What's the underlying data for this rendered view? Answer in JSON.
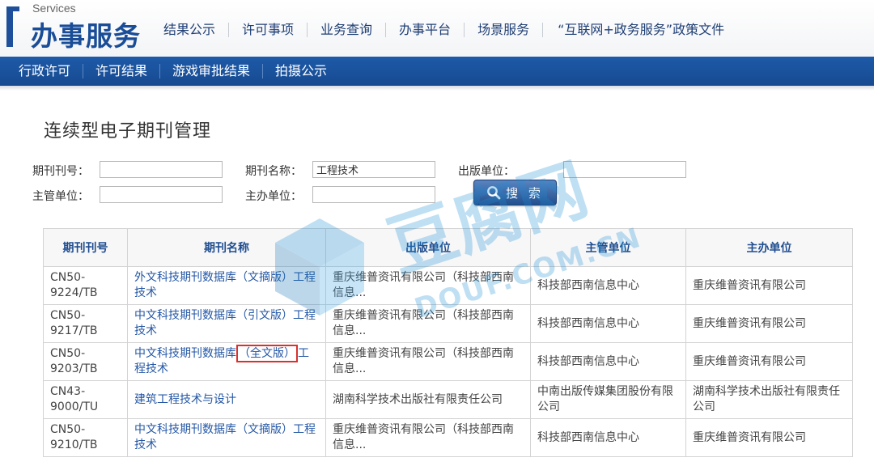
{
  "header": {
    "logo_small": "Services",
    "logo_title": "办事服务",
    "nav": [
      {
        "label": "结果公示"
      },
      {
        "label": "许可事项"
      },
      {
        "label": "业务查询"
      },
      {
        "label": "办事平台"
      },
      {
        "label": "场景服务"
      },
      {
        "label": "“互联网+政务服务”政策文件"
      }
    ]
  },
  "subnav": [
    {
      "label": "行政许可"
    },
    {
      "label": "许可结果"
    },
    {
      "label": "游戏审批结果"
    },
    {
      "label": "拍摄公示"
    }
  ],
  "page_title": "连续型电子期刊管理",
  "form": {
    "issn_label": "期刊刊号：",
    "issn_value": "",
    "name_label": "期刊名称：",
    "name_value": "工程技术",
    "publisher_label": "出版单位：",
    "publisher_value": "",
    "supervisor_label": "主管单位：",
    "supervisor_value": "",
    "sponsor_label": "主办单位：",
    "sponsor_value": "",
    "search_label": "搜 索"
  },
  "table": {
    "headers": [
      "期刊刊号",
      "期刊名称",
      "出版单位",
      "主管单位",
      "主办单位"
    ],
    "rows": [
      {
        "issn": "CN50-9224/TB",
        "name_a": "外文科技期刊数据库（文摘版）工程技术",
        "name_hl": "",
        "name_b": "",
        "publisher": "重庆维普资讯有限公司（科技部西南信息...",
        "supervisor": "科技部西南信息中心",
        "sponsor": "重庆维普资讯有限公司"
      },
      {
        "issn": "CN50-9217/TB",
        "name_a": "中文科技期刊数据库（引文版）工程技术",
        "name_hl": "",
        "name_b": "",
        "publisher": "重庆维普资讯有限公司（科技部西南信息...",
        "supervisor": "科技部西南信息中心",
        "sponsor": "重庆维普资讯有限公司"
      },
      {
        "issn": "CN50-9203/TB",
        "name_a": "中文科技期刊数据库",
        "name_hl": "（全文版）",
        "name_b": "工程技术",
        "publisher": "重庆维普资讯有限公司（科技部西南信息...",
        "supervisor": "科技部西南信息中心",
        "sponsor": "重庆维普资讯有限公司"
      },
      {
        "issn": "CN43-9000/TU",
        "name_a": "建筑工程技术与设计",
        "name_hl": "",
        "name_b": "",
        "publisher": "湖南科学技术出版社有限责任公司",
        "supervisor": "中南出版传媒集团股份有限公司",
        "sponsor": "湖南科学技术出版社有限责任公司"
      },
      {
        "issn": "CN50-9210/TB",
        "name_a": "中文科技期刊数据库（文摘版）工程技术",
        "name_hl": "",
        "name_b": "",
        "publisher": "重庆维普资讯有限公司（科技部西南信息...",
        "supervisor": "科技部西南信息中心",
        "sponsor": "重庆维普资讯有限公司"
      }
    ]
  },
  "watermark": {
    "text1": "豆腐网",
    "text2": "DOUF.COM.CN",
    "color": "#1e8fd6"
  }
}
